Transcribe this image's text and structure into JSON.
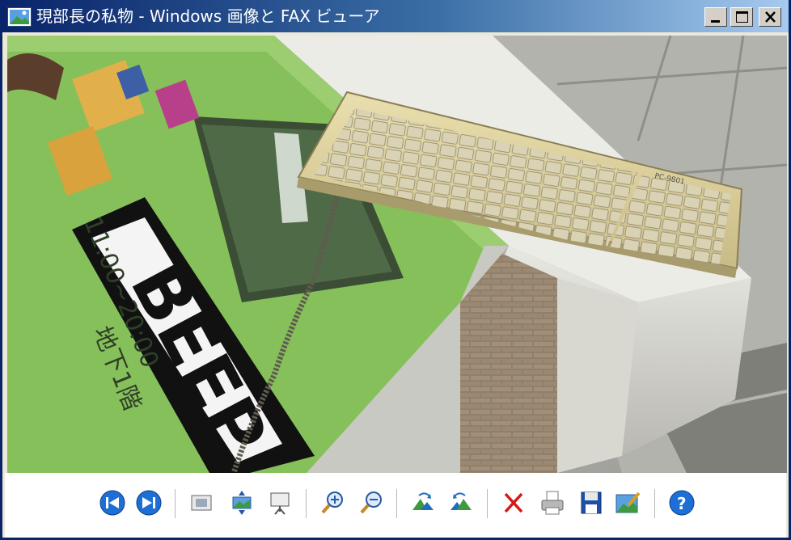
{
  "window": {
    "title": "現部長の私物 - Windows 画像と FAX ビューア"
  },
  "image": {
    "sign_text": "BEEP",
    "sign_hours": "11:00~20:00",
    "sign_floor": "地下1階",
    "keyboard_label": "PC-9801"
  },
  "toolbar": {
    "buttons": [
      "previous-image",
      "next-image",
      "best-fit",
      "actual-size",
      "slideshow",
      "zoom-in",
      "zoom-out",
      "rotate-clockwise",
      "rotate-counterclockwise",
      "delete",
      "print",
      "save",
      "edit"
    ],
    "help": "help"
  }
}
